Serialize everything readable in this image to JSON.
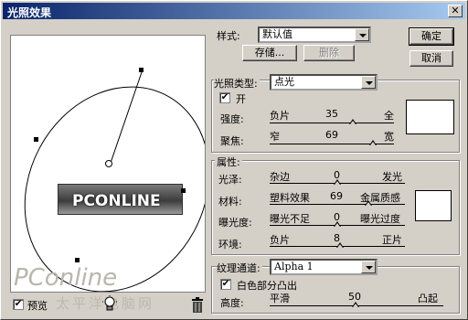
{
  "window": {
    "title": "光照效果",
    "close_glyph": "✕"
  },
  "buttons": {
    "ok": "确定",
    "cancel": "取消",
    "save": "存储...",
    "delete": "删除"
  },
  "style": {
    "label": "样式:",
    "value": "默认值"
  },
  "light": {
    "type_label": "光照类型:",
    "type_value": "点光",
    "on_label": "开",
    "on_checked": true,
    "intensity_label": "强度:",
    "intensity_min": "负片",
    "intensity_value": "35",
    "intensity_max": "全",
    "focus_label": "聚焦:",
    "focus_min": "窄",
    "focus_value": "69",
    "focus_max": "宽",
    "color": "#ffffff"
  },
  "properties": {
    "group_label": "属性:",
    "gloss_label": "光泽:",
    "gloss_min": "杂边",
    "gloss_value": "0",
    "gloss_max": "发光",
    "material_label": "材料:",
    "material_min": "塑料效果",
    "material_value": "69",
    "material_max": "金属质感",
    "exposure_label": "曝光度:",
    "exposure_min": "曝光不足",
    "exposure_value": "0",
    "exposure_max": "曝光过度",
    "ambience_label": "环境:",
    "ambience_min": "负片",
    "ambience_value": "8",
    "ambience_max": "正片",
    "color": "#ffffff"
  },
  "texture": {
    "channel_label": "纹理通道:",
    "channel_value": "Alpha 1",
    "white_high_label": "白色部分凸出",
    "white_high_checked": true,
    "height_label": "高度:",
    "height_min": "平滑",
    "height_value": "50",
    "height_max": "凸起"
  },
  "preview": {
    "label": "预览",
    "checked": true,
    "image_text": "PCONLINE",
    "light_icon": "lightbulb-icon",
    "trash_icon": "trash-icon"
  },
  "watermark": {
    "brand": "PConline",
    "cn": "太平洋电脑网"
  }
}
